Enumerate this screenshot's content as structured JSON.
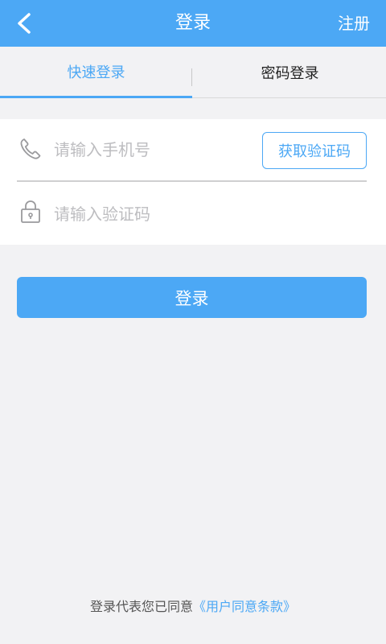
{
  "header": {
    "title": "登录",
    "register_label": "注册",
    "back_icon": "chevron-left-icon"
  },
  "tabs": [
    {
      "label": "快速登录",
      "active": true
    },
    {
      "label": "密码登录",
      "active": false
    }
  ],
  "form": {
    "phone": {
      "placeholder": "请输入手机号",
      "value": "",
      "icon": "phone-icon"
    },
    "code": {
      "placeholder": "请输入验证码",
      "value": "",
      "icon": "lock-icon"
    },
    "sms_button_label": "获取验证码"
  },
  "login_button_label": "登录",
  "agreement": {
    "prefix": "登录代表您已同意",
    "link": "《用户同意条款》"
  },
  "colors": {
    "accent": "#4ca8f5",
    "background": "#f2f2f4",
    "placeholder": "#bdbdc0"
  }
}
